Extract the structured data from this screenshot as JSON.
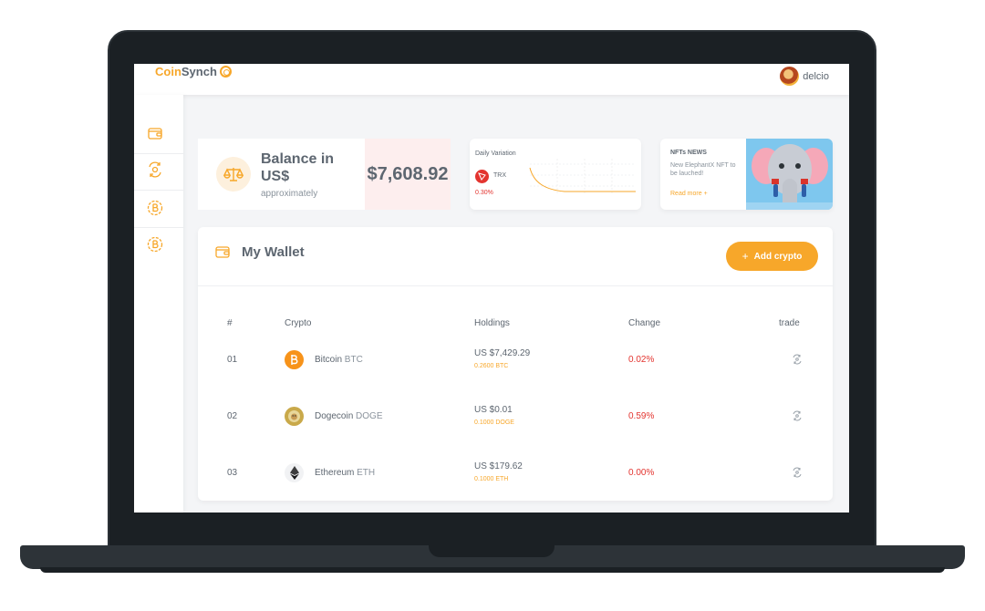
{
  "app": {
    "logo_part1": "Coin",
    "logo_part2": "Synch"
  },
  "user": {
    "name": "delcio"
  },
  "sidebar": {
    "items": [
      {
        "icon": "wallet-icon"
      },
      {
        "icon": "exchange-icon"
      },
      {
        "icon": "bitcoin-icon"
      },
      {
        "icon": "bitcoin-icon"
      }
    ]
  },
  "balance": {
    "title": "Balance in US$",
    "subtitle": "approximately",
    "value": "$7,608.92"
  },
  "daily_variation": {
    "title": "Daily Variation",
    "coin": "TRX",
    "change": "0.30%"
  },
  "nft_news": {
    "title": "NFTs NEWS",
    "text": "New ElephantX NFT to be lauched!",
    "link": "Read more +"
  },
  "wallet": {
    "title": "My Wallet",
    "add_button": "Add crypto",
    "columns": [
      "#",
      "Crypto",
      "Holdings",
      "Change",
      "trade"
    ],
    "rows": [
      {
        "index": "01",
        "name": "Bitcoin",
        "symbol": "BTC",
        "holdings_usd": "US $7,429.29",
        "holdings_coin": "0.2600 BTC",
        "change": "0.02%",
        "icon": "bitcoin-icon"
      },
      {
        "index": "02",
        "name": "Dogecoin",
        "symbol": "DOGE",
        "holdings_usd": "US $0.01",
        "holdings_coin": "0.1000 DOGE",
        "change": "0.59%",
        "icon": "dogecoin-icon"
      },
      {
        "index": "03",
        "name": "Ethereum",
        "symbol": "ETH",
        "holdings_usd": "US $179.62",
        "holdings_coin": "0.1000 ETH",
        "change": "0.00%",
        "icon": "ethereum-icon"
      }
    ]
  },
  "colors": {
    "accent": "#f7a72a",
    "negative": "#e3342f",
    "text": "#5d6670",
    "frame": "#1b2024"
  }
}
